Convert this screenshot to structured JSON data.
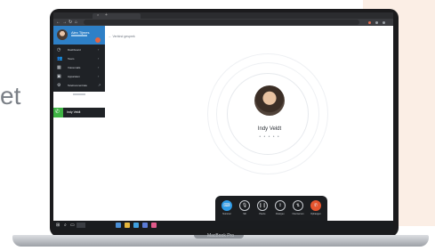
{
  "page": {
    "background_text": "et",
    "laptop_label": "MacBook Pro"
  },
  "colors": {
    "accent_blue": "#2e80c7",
    "call_green": "#3fb344",
    "hangup_red": "#e5552f",
    "peach": "#fbeee5"
  },
  "browser": {
    "tab_close": "×",
    "tab_new": "+",
    "nav": [
      "←",
      "→",
      "↻",
      "⌂"
    ]
  },
  "sidebar": {
    "user_name": "Alex Tijmes",
    "menu": [
      {
        "icon": "clock-icon",
        "glyph": "◷",
        "label": "Dashboard"
      },
      {
        "icon": "people-icon",
        "glyph": "👥",
        "label": "Team"
      },
      {
        "icon": "dialpad-icon",
        "glyph": "▦",
        "label": "Voicemails"
      },
      {
        "icon": "device-icon",
        "glyph": "▣",
        "label": "Apparaten"
      },
      {
        "icon": "settings-icon",
        "glyph": "⚙",
        "label": "Telefooncentrale"
      }
    ],
    "call_card": {
      "name": "Indy Veldt",
      "icon": "phone-icon",
      "glyph": "✆"
    }
  },
  "main": {
    "back_link": "← Verbind gesprek",
    "callee_name": "Indy Veldt",
    "callee_status": "• • • • •"
  },
  "controls": [
    {
      "name": "keypad",
      "glyph": "⌨",
      "label": "Nummer"
    },
    {
      "name": "mute",
      "glyph": "🎙",
      "label": "Stil"
    },
    {
      "name": "hold",
      "glyph": "❙❙",
      "label": "Pauze"
    },
    {
      "name": "transfer",
      "glyph": "⇪",
      "label": "Doorgev."
    },
    {
      "name": "consult",
      "glyph": "⇅",
      "label": "Overnemen"
    },
    {
      "name": "hangup",
      "glyph": "✆",
      "label": "Ophangen"
    }
  ]
}
